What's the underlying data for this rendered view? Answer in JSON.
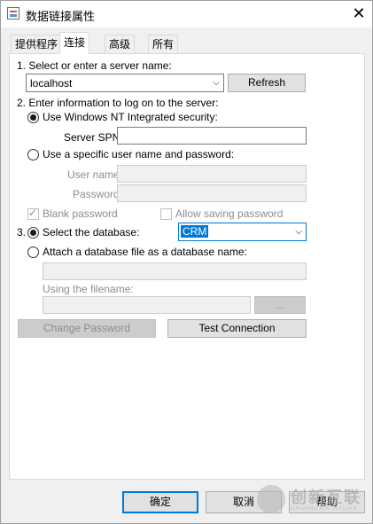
{
  "window": {
    "title": "数据链接属性",
    "close_glyph": "✕"
  },
  "tabs": [
    {
      "label": "提供程序",
      "active": false
    },
    {
      "label": "连接",
      "active": true
    },
    {
      "label": "高级",
      "active": false
    },
    {
      "label": "所有",
      "active": false
    }
  ],
  "step1": {
    "label": "1. Select or enter a server name:",
    "server_value": "localhost",
    "refresh_label": "Refresh"
  },
  "step2": {
    "label": "2. Enter information to log on to the server:",
    "nt_security_label": "Use Windows NT Integrated security:",
    "spn_label": "Server SPN:",
    "spn_value": "",
    "specific_label": "Use a specific user name and password:",
    "username_label": "User name:",
    "username_value": "",
    "password_label": "Password:",
    "password_value": "",
    "blank_password_label": "Blank password",
    "allow_saving_label": "Allow saving password",
    "nt_security_selected": true,
    "blank_password_checked": true,
    "allow_saving_checked": false
  },
  "step3": {
    "number": "3.",
    "select_db_label": "Select the database:",
    "db_value": "CRM",
    "attach_label": "Attach a database file as a database name:",
    "attach_value": "",
    "using_filename_label": "Using the filename:",
    "filename_value": "",
    "browse_label": "...",
    "select_db_selected": true
  },
  "buttons": {
    "change_password": "Change Password",
    "test_connection": "Test Connection",
    "ok": "确定",
    "cancel": "取消",
    "help": "帮助"
  },
  "watermark": {
    "text": "创新互联",
    "sub": "CHUANGXIN HULIAN"
  },
  "colors": {
    "accent": "#0078d7",
    "window_bg": "#f0f0f0",
    "panel_bg": "#ffffff",
    "disabled_text": "#8c8c8c"
  }
}
